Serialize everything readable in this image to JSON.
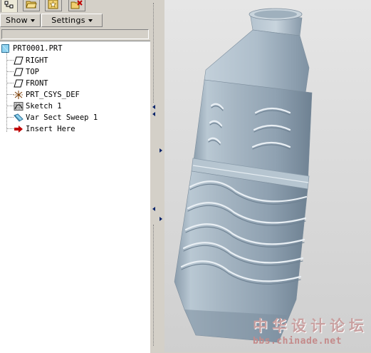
{
  "toolbar": {
    "show_label": "Show",
    "settings_label": "Settings"
  },
  "model_tree": {
    "root": "PRT0001.PRT",
    "items": [
      {
        "label": "RIGHT",
        "icon": "datum-plane-icon"
      },
      {
        "label": "TOP",
        "icon": "datum-plane-icon"
      },
      {
        "label": "FRONT",
        "icon": "datum-plane-icon"
      },
      {
        "label": "PRT_CSYS_DEF",
        "icon": "coordinate-system-icon"
      },
      {
        "label": "Sketch 1",
        "icon": "sketch-icon"
      },
      {
        "label": "Var Sect Sweep 1",
        "icon": "sweep-icon"
      },
      {
        "label": "Insert Here",
        "icon": "insert-arrow-icon"
      }
    ]
  },
  "watermark": {
    "cn": "中华设计论坛",
    "url": "bbs.chinade.net"
  },
  "colors": {
    "panel_bg": "#d4d0c8",
    "tree_bg": "#ffffff",
    "viewport_bg": "#dcdcdc",
    "model_base": "#a8b8c4",
    "model_shadow": "#6f8293",
    "insert_arrow": "#c00000"
  }
}
